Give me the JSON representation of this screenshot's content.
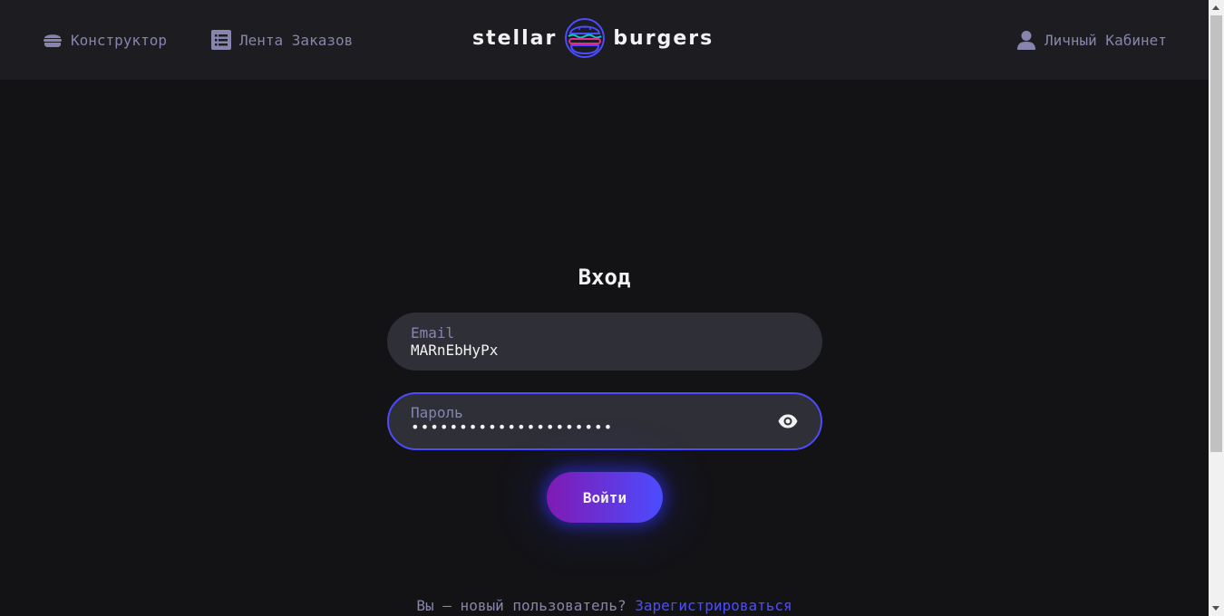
{
  "header": {
    "nav": {
      "constructor": "Конструктор",
      "feed": "Лента Заказов",
      "account": "Личный Кабинет"
    },
    "logo": {
      "left": "stellar",
      "right": "burgers"
    }
  },
  "login": {
    "title": "Вход",
    "email_label": "Email",
    "email_value": "MARnEbHyPx",
    "password_label": "Пароль",
    "password_value": "•••••••••••••••••••••",
    "submit": "Войти",
    "register_prompt": "Вы — новый пользователь?",
    "register_link": "Зарегистрироваться"
  },
  "colors": {
    "accent": "#4c4cff",
    "text_inactive": "#8585ad",
    "button_gradient_start": "#801ab3"
  },
  "icons": {
    "constructor": "burger-icon",
    "feed": "list-icon",
    "account": "profile-icon",
    "password_toggle": "eye-icon"
  }
}
